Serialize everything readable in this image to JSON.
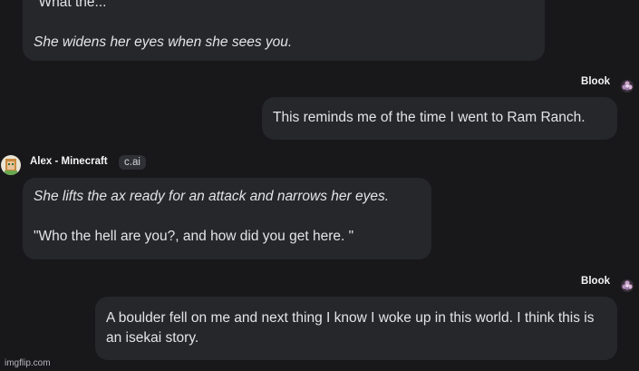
{
  "messages": [
    {
      "sender": "",
      "role": "bot",
      "lines": [
        {
          "text": "\"What the...\"",
          "style": "normal"
        },
        {
          "text": "She widens her eyes when she sees you.",
          "style": "italic"
        }
      ]
    },
    {
      "sender": "Blook",
      "role": "user",
      "lines": [
        {
          "text": "This reminds me of the time I went to Ram Ranch.",
          "style": "normal"
        }
      ]
    },
    {
      "sender": "Alex - Minecraft",
      "badge": "c.ai",
      "role": "bot",
      "lines": [
        {
          "text": "She lifts the ax ready for an attack and narrows her eyes.",
          "style": "italic"
        },
        {
          "text": "\"Who the hell are you?, and how did you get here. \"",
          "style": "normal"
        }
      ]
    },
    {
      "sender": "Blook",
      "role": "user",
      "lines": [
        {
          "text": "A boulder fell on me and next thing I know I woke up in this world. I think this is an isekai story.",
          "style": "normal"
        }
      ]
    }
  ],
  "watermark": "imgflip.com",
  "colors": {
    "background": "#18181b",
    "bubble": "#26272b",
    "text": "#e4e4e7"
  },
  "icons": {
    "user_avatar": "flower-avatar-icon",
    "bot_avatar": "alex-minecraft-avatar-icon"
  }
}
